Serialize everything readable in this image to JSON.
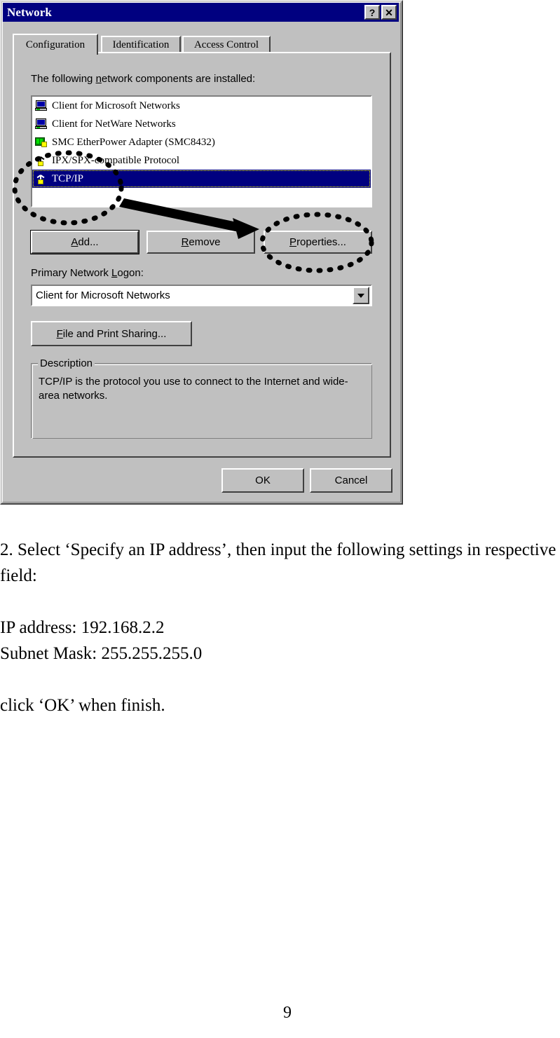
{
  "dialog": {
    "title": "Network",
    "titlebar_buttons": [
      {
        "name": "help-button",
        "glyph": "?"
      },
      {
        "name": "close-button",
        "glyph": "✕"
      }
    ],
    "tabs": [
      {
        "label": "Configuration",
        "active": true
      },
      {
        "label": "Identification",
        "active": false
      },
      {
        "label": "Access Control",
        "active": false
      }
    ],
    "list_label_pre": "The following ",
    "list_label_accel": "n",
    "list_label_post": "etwork components are installed:",
    "components": [
      {
        "label": "Client for Microsoft Networks",
        "icon": "computer-icon",
        "selected": false
      },
      {
        "label": "Client for NetWare Networks",
        "icon": "computer-icon",
        "selected": false
      },
      {
        "label": "SMC EtherPower Adapter (SMC8432)",
        "icon": "network-adapter-icon",
        "selected": false
      },
      {
        "label": "IPX/SPX-compatible Protocol",
        "icon": "protocol-icon",
        "selected": false
      },
      {
        "label": "TCP/IP",
        "icon": "protocol-icon",
        "selected": true
      }
    ],
    "buttons": {
      "add": {
        "accel": "A",
        "rest": "dd..."
      },
      "remove": {
        "accel": "R",
        "rest": "emove"
      },
      "properties": {
        "accel": "P",
        "rest": "roperties..."
      },
      "file_print_sharing": {
        "accel": "F",
        "rest": "ile and Print Sharing..."
      },
      "ok": "OK",
      "cancel": "Cancel"
    },
    "logon_label_pre": "Primary Network ",
    "logon_label_accel": "L",
    "logon_label_post": "ogon:",
    "logon_value": "Client for Microsoft Networks",
    "description": {
      "title": "Description",
      "text": "TCP/IP is the protocol you use to connect to the Internet and wide-area networks."
    },
    "colors": {
      "titlebar": "#000080",
      "face": "#c0c0c0",
      "selection": "#000080",
      "focus_outline": "#ffff00"
    }
  },
  "annotations": {
    "ellipse_tcpip": "highlight-ellipse-tcpip",
    "ellipse_properties": "highlight-ellipse-properties",
    "arrow": "pointer-arrow"
  },
  "document": {
    "step": "2. Select ‘Specify an IP address’, then input the following settings in respective field:",
    "ip_address": "IP address: 192.168.2.2",
    "subnet_mask": "Subnet Mask: 255.255.255.0",
    "closing": "click ‘OK’ when finish.",
    "page_number": "9"
  }
}
